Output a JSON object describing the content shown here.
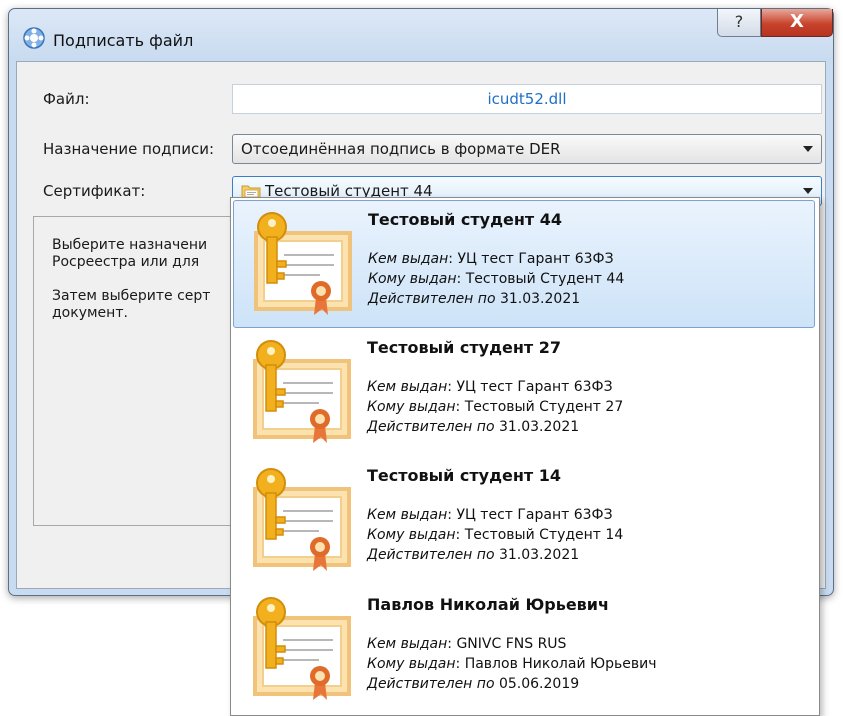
{
  "window": {
    "title": "Подписать файл",
    "help_label": "?",
    "close_label": "X"
  },
  "form": {
    "file_label": "Файл:",
    "file_value": "icudt52.dll",
    "purpose_label": "Назначение подписи:",
    "purpose_value": "Отсоединённая подпись в формате DER",
    "cert_label": "Сертификат:",
    "cert_value": "Тестовый студент 44"
  },
  "info": {
    "line1": "Выберите назначени",
    "line2": "Росреестра или для",
    "line3": "Затем выберите серт",
    "line4": "документ."
  },
  "labels": {
    "issued_by": "Кем выдан",
    "issued_to": "Кому выдан",
    "valid_until": "Действителен по"
  },
  "certificates": [
    {
      "name": "Тестовый студент 44",
      "issuer": "УЦ тест Гарант 63ФЗ",
      "owner": "Тестовый Студент 44",
      "valid": "31.03.2021"
    },
    {
      "name": "Тестовый студент 27",
      "issuer": "УЦ тест Гарант 63ФЗ",
      "owner": "Тестовый Студент 27",
      "valid": "31.03.2021"
    },
    {
      "name": "Тестовый студент 14",
      "issuer": "УЦ тест Гарант 63ФЗ",
      "owner": "Тестовый Студент 14",
      "valid": "31.03.2021"
    },
    {
      "name": "Павлов Николай Юрьевич",
      "issuer": "GNIVC FNS RUS",
      "owner": "Павлов Николай Юрьевич",
      "valid": "05.06.2019"
    }
  ],
  "colors": {
    "accent": "#3d7cc9",
    "file_text": "#1f6fc6",
    "key": "#f2b01e",
    "certificate_frame": "#f0c27a",
    "seal": "#e06a2a"
  },
  "icons": [
    "app-icon",
    "help-icon",
    "close-icon",
    "folder-icon",
    "certificate-key-icon",
    "chevron-down-icon"
  ]
}
